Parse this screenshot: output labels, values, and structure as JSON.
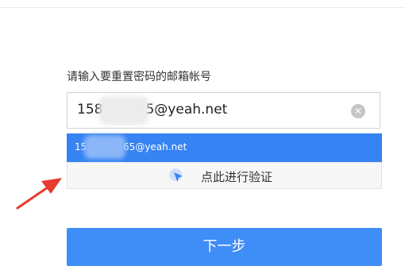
{
  "form": {
    "label": "请输入要重置密码的邮箱帐号",
    "input_value": "158        65@yeah.net",
    "suggestion": "15          465@yeah.net",
    "verify_label": "点此进行验证",
    "next_label": "下一步"
  },
  "colors": {
    "primary": "#3f8df7",
    "suggestion_bg": "#3683f3",
    "arrow": "#e83a2f"
  },
  "icons": {
    "clear": "clear-icon",
    "verify": "cursor-shield-icon",
    "annotation": "red-arrow-icon"
  }
}
